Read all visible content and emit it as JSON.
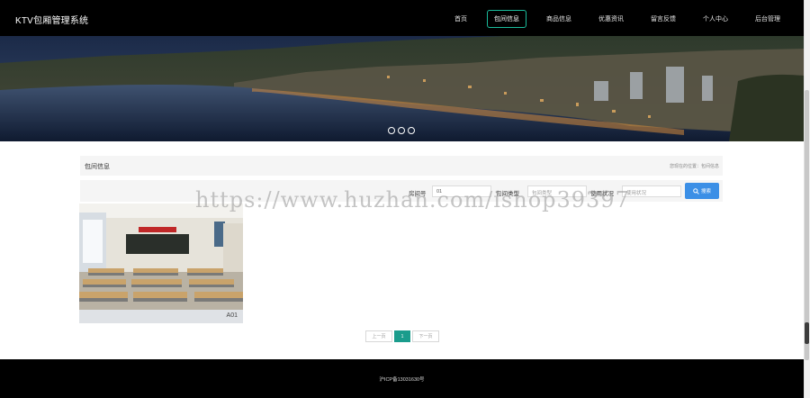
{
  "header": {
    "brand": "KTV包厢管理系统",
    "nav": [
      {
        "label": "首页"
      },
      {
        "label": "包间信息",
        "active": true
      },
      {
        "label": "商品信息"
      },
      {
        "label": "优惠资讯"
      },
      {
        "label": "留言反馈"
      },
      {
        "label": "个人中心"
      },
      {
        "label": "后台管理"
      }
    ]
  },
  "banner": {
    "slide_count": 3,
    "active_slide": 1
  },
  "section": {
    "title": "包间信息",
    "breadcrumb": "您现在的位置：包间信息"
  },
  "filters": {
    "room_no_label": "房间号",
    "room_no_value": "01",
    "room_type_label": "包间类型",
    "room_type_placeholder": "包间类型",
    "usage_label": "使用状况",
    "usage_placeholder": "使用状况",
    "search_label": "搜索"
  },
  "rooms": [
    {
      "name": "A01"
    }
  ],
  "pagination": {
    "prev_label": "上一页",
    "current": "1",
    "next_label": "下一页"
  },
  "footer": {
    "icp": "沪ICP备13031630号"
  },
  "watermark": "https://www.huzhan.com/ishop39397",
  "colors": {
    "accent": "#1abc9c",
    "search_button": "#3b8fe6",
    "active_page": "#1a9c8c",
    "header_bg": "#000000"
  }
}
